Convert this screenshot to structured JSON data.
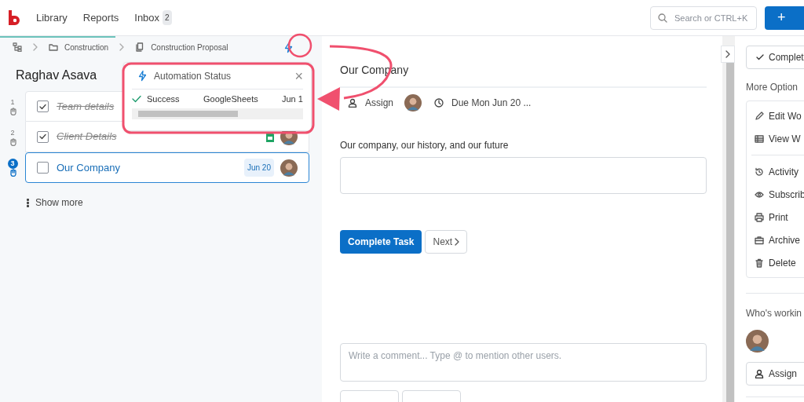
{
  "nav": {
    "items": [
      {
        "label": "Library"
      },
      {
        "label": "Reports"
      },
      {
        "label": "Inbox",
        "badge": "2"
      }
    ],
    "search": {
      "placeholder": "Search or CTRL+K"
    },
    "add_button": "+"
  },
  "breadcrumb": [
    "Construction",
    "Construction Proposal"
  ],
  "assignee": "Raghav Asava",
  "tasks": [
    {
      "number": "1",
      "title": "Team details",
      "checked": true,
      "selected": false
    },
    {
      "number": "2",
      "title": "Client Details",
      "checked": true,
      "selected": false,
      "sheet": true
    },
    {
      "number": "3",
      "title": "Our Company",
      "checked": false,
      "selected": true,
      "due": "Jun 20"
    }
  ],
  "show_more": "Show more",
  "automation_popup": {
    "title": "Automation Status",
    "close": "×",
    "rows": [
      {
        "status": "Success",
        "app": "GoogleSheets",
        "date": "Jun 1"
      }
    ]
  },
  "task": {
    "title": "Our Company",
    "assign": "Assign",
    "due": "Due Mon Jun 20 ...",
    "field_label": "Our company, our history, and our future",
    "complete_button": "Complete Task",
    "next_button": "Next",
    "comment": {
      "placeholder": "Write a comment... Type @ to mention other users."
    }
  },
  "right_panel": {
    "complete_button": "Complet",
    "more_options_label": "More Option",
    "options": [
      {
        "kind": "pencil",
        "label": "Edit Wo"
      },
      {
        "kind": "table",
        "label": "View W"
      },
      {
        "kind": "divider"
      },
      {
        "kind": "history",
        "label": "Activity"
      },
      {
        "kind": "eye",
        "label": "Subscrib"
      },
      {
        "kind": "printer",
        "label": "Print"
      },
      {
        "kind": "archive",
        "label": "Archive"
      },
      {
        "kind": "trash",
        "label": "Delete"
      }
    ],
    "working_label": "Who's workin",
    "assign_button": "Assign"
  }
}
